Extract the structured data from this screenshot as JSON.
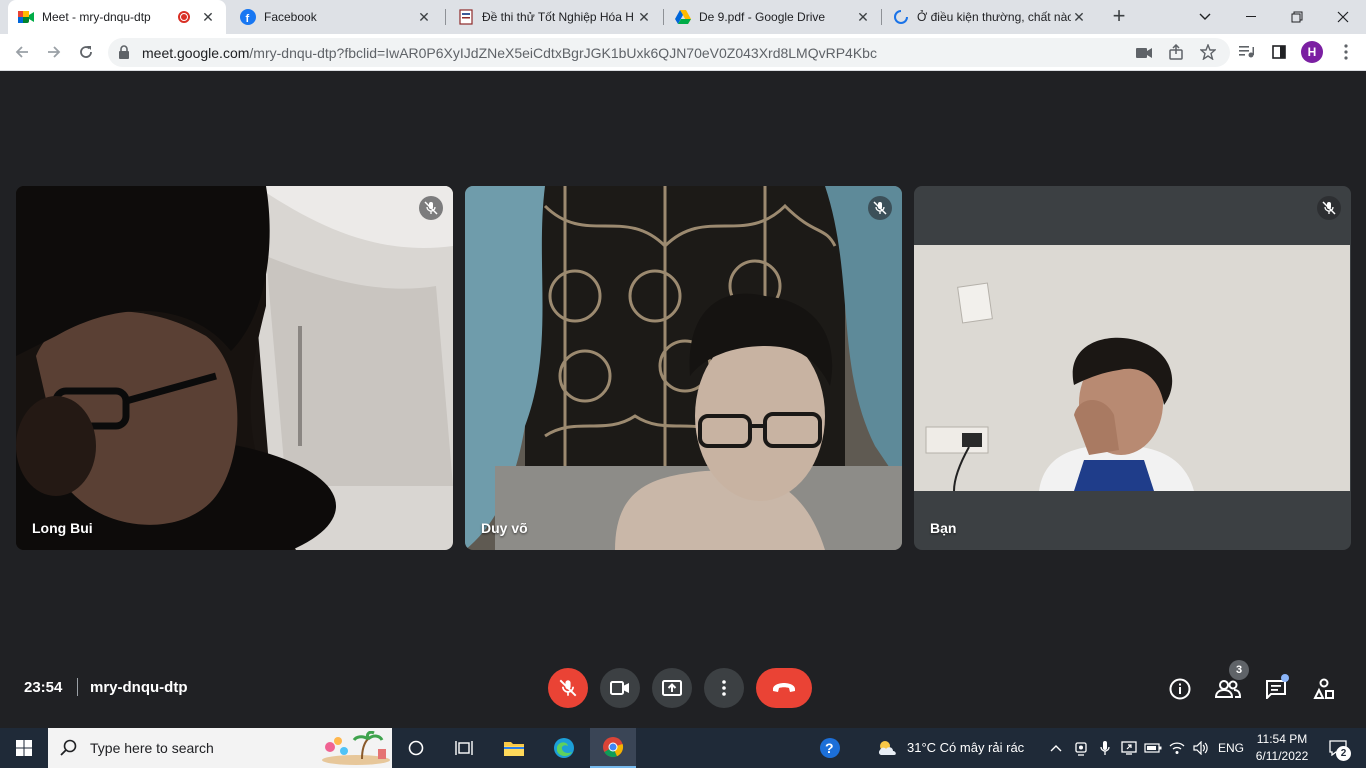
{
  "browser": {
    "tabs": [
      {
        "title": "Meet - mry-dnqu-dtp",
        "icon": "google-meet-icon",
        "recording": true
      },
      {
        "title": "Facebook",
        "icon": "facebook-icon"
      },
      {
        "title": "Đề thi thử Tốt Nghiệp Hóa H",
        "icon": "document-icon"
      },
      {
        "title": "De 9.pdf - Google Drive",
        "icon": "google-drive-icon"
      },
      {
        "title": "Ở điều kiện thường, chất nào",
        "icon": "loading-icon"
      }
    ],
    "url_host": "meet.google.com",
    "url_path": "/mry-dnqu-dtp?fbclid=IwAR0P6XyIJdZNeX5eiCdtxBgrJGK1bUxk6QJN70eV0Z043Xrd8LMQvRP4Kbc",
    "profile_initial": "H"
  },
  "meet": {
    "participants": [
      {
        "name": "Long Bui",
        "muted": true
      },
      {
        "name": "Duy võ",
        "muted": true
      },
      {
        "name": "Bạn",
        "muted": true
      }
    ],
    "time": "23:54",
    "meeting_code": "mry-dnqu-dtp",
    "participant_count": "3"
  },
  "taskbar": {
    "search_placeholder": "Type here to search",
    "weather": "31°C  Có mây rải rác",
    "language": "ENG",
    "time": "11:54 PM",
    "date": "6/11/2022",
    "notification_count": "2"
  },
  "colors": {
    "meet_background": "#202124",
    "end_call_red": "#ea4335",
    "control_gray": "#3c4043",
    "taskbar": "#1f2a38"
  }
}
